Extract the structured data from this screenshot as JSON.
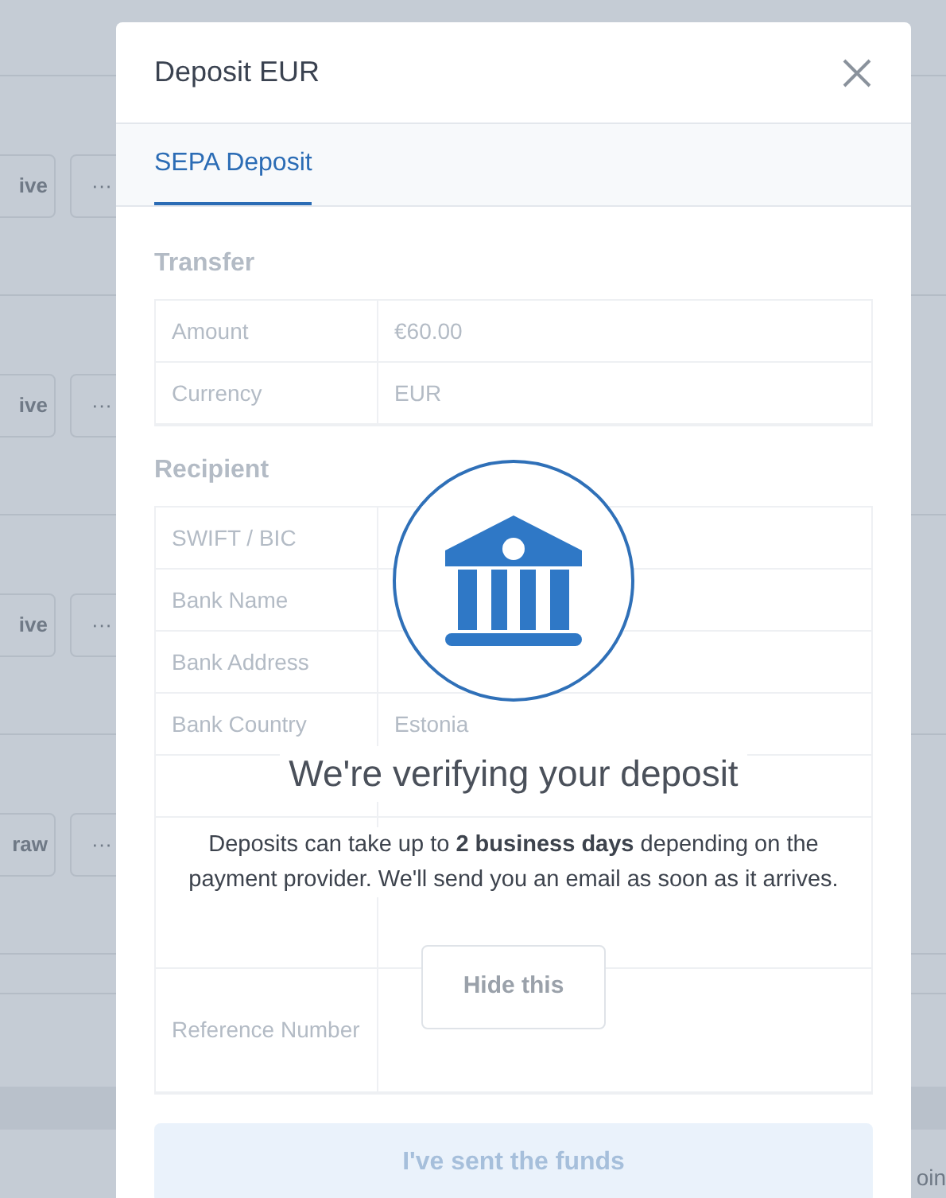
{
  "background": {
    "row_buttons": [
      {
        "label": "ive"
      },
      {
        "label": "ive"
      },
      {
        "label": "ive"
      },
      {
        "label": "raw"
      }
    ],
    "more_label": "···",
    "footer_text": "oin"
  },
  "modal": {
    "title": "Deposit EUR",
    "tabs": [
      {
        "label": "SEPA Deposit",
        "selected": true
      }
    ],
    "faded": {
      "sections": [
        {
          "title": "Transfer",
          "rows": [
            {
              "kind": "short",
              "label": "Amount",
              "value": "€60.00"
            },
            {
              "kind": "short",
              "label": "Currency",
              "value": "EUR"
            }
          ]
        },
        {
          "title": "Recipient",
          "rows": [
            {
              "kind": "short",
              "label": "SWIFT / BIC"
            },
            {
              "kind": "short",
              "label": "Bank Name"
            },
            {
              "kind": "short",
              "label": "Bank Address"
            },
            {
              "kind": "short",
              "label": "Bank Country",
              "value": "Estonia"
            },
            {
              "kind": "short"
            },
            {
              "kind": "tall"
            },
            {
              "kind": "medium",
              "label": "Reference Number"
            }
          ]
        }
      ],
      "submit": "I've sent the funds"
    },
    "notice": {
      "title": "We're verifying your deposit",
      "body": "Deposits can take up to **2 business days** depending on the payment provider. We'll send you an email as soon as it arrives.",
      "button": "Hide this"
    }
  }
}
